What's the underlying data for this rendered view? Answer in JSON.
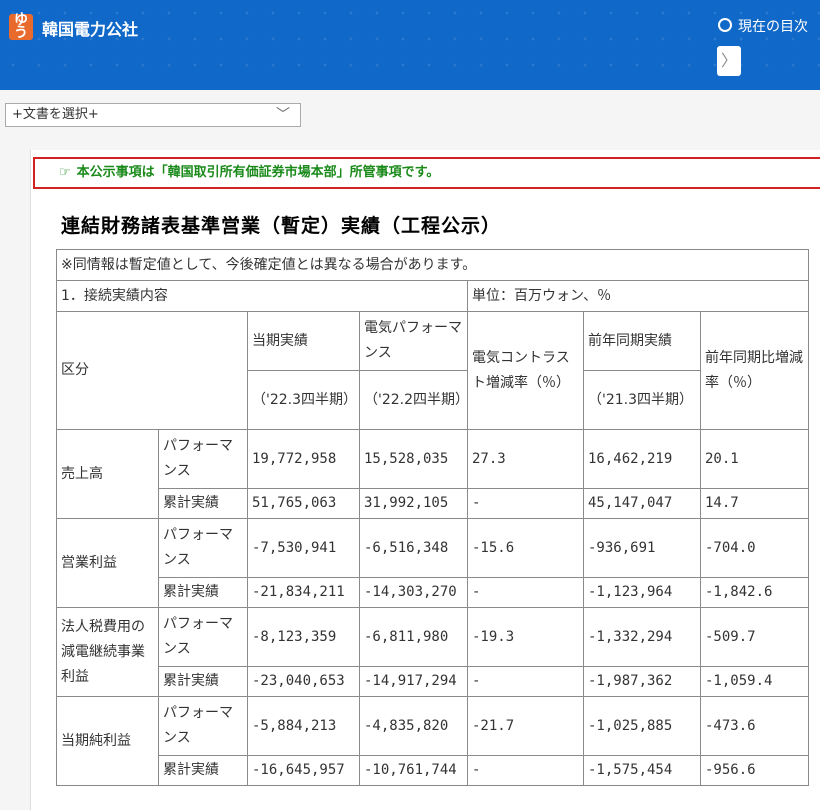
{
  "header": {
    "logo_text_1": "ゆ",
    "logo_text_2": "う",
    "company": "韓国電力公社",
    "toc_label": "現在の目次",
    "nav_arrow": "〉"
  },
  "doc_select": {
    "value": "+文書を選択+",
    "chevron": "﹀"
  },
  "notice": {
    "icon": "☞",
    "text": "本公示事項は「韓国取引所有価証券市場本部」所管事項です。"
  },
  "title": "連結財務諸表基準営業（暫定）実績（工程公示）",
  "table": {
    "note": "※同情報は暫定値として、今後確定値とは異なる場合があります。",
    "section": "1．接続実績内容",
    "unit": "単位：百万ウォン、％",
    "headers": {
      "category": "区分",
      "current": "当期実績",
      "current_period": "（'22.3四半期）",
      "prev": "電気パフォーマンス",
      "prev_period": "（'22.2四半期）",
      "qoq": "電気コントラスト増減率（％）",
      "yoy": "前年同期実績",
      "yoy_period": "（'21.3四半期）",
      "yoy_rate": "前年同期比増減率（％）"
    },
    "groups": [
      {
        "name": "売上高",
        "rows": [
          {
            "label": "パフォーマンス",
            "values": [
              "19,772,958",
              "15,528,035",
              "27.3",
              "16,462,219",
              "20.1"
            ]
          },
          {
            "label": "累計実績",
            "values": [
              "51,765,063",
              "31,992,105",
              "-",
              "45,147,047",
              "14.7"
            ]
          }
        ]
      },
      {
        "name": "営業利益",
        "rows": [
          {
            "label": "パフォーマンス",
            "values": [
              "-7,530,941",
              "-6,516,348",
              "-15.6",
              "-936,691",
              "-704.0"
            ]
          },
          {
            "label": "累計実績",
            "values": [
              "-21,834,211",
              "-14,303,270",
              "-",
              "-1,123,964",
              "-1,842.6"
            ]
          }
        ]
      },
      {
        "name": "法人税費用の減電継続事業利益",
        "rows": [
          {
            "label": "パフォーマンス",
            "values": [
              "-8,123,359",
              "-6,811,980",
              "-19.3",
              "-1,332,294",
              "-509.7"
            ]
          },
          {
            "label": "累計実績",
            "values": [
              "-23,040,653",
              "-14,917,294",
              "-",
              "-1,987,362",
              "-1,059.4"
            ]
          }
        ]
      },
      {
        "name": "当期純利益",
        "rows": [
          {
            "label": "パフォーマンス",
            "values": [
              "-5,884,213",
              "-4,835,820",
              "-21.7",
              "-1,025,885",
              "-473.6"
            ]
          },
          {
            "label": "累計実績",
            "values": [
              "-16,645,957",
              "-10,761,744",
              "-",
              "-1,575,454",
              "-956.6"
            ]
          }
        ]
      }
    ]
  },
  "colors": {
    "header_bg": "#1068c8",
    "notice_border": "#d32222",
    "notice_text": "#1a8a1a",
    "logo_bg": "#e86a2c"
  }
}
